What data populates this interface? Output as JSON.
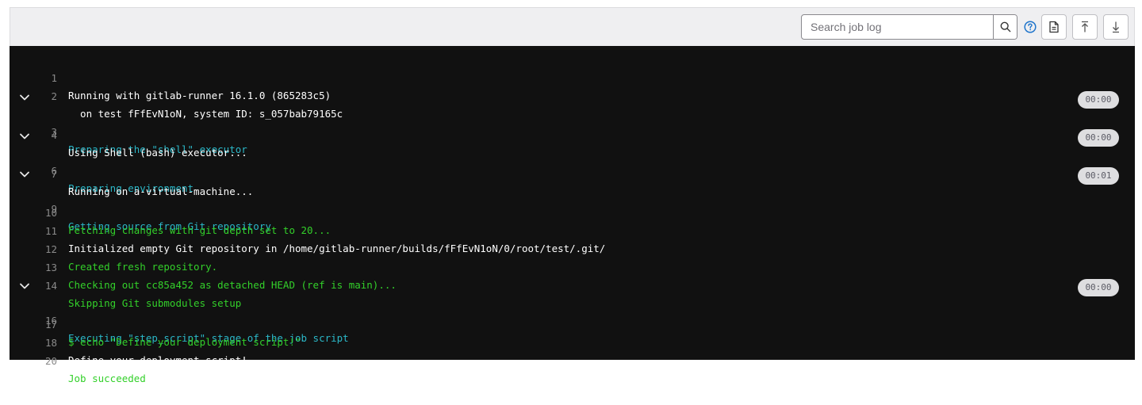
{
  "toolbar": {
    "search_placeholder": "Search job log",
    "search_value": "",
    "icons": {
      "search": "search-icon",
      "help": "question-circle-icon",
      "raw": "document-icon",
      "scroll_top": "scroll-up-icon",
      "scroll_bottom": "scroll-down-icon"
    },
    "accent_color": "#1f75cb"
  },
  "log": {
    "colors": {
      "background": "#111111",
      "line_number": "#8a8a8a",
      "section": "#2bb8c8",
      "success": "#33d02a",
      "default": "#ffffff"
    },
    "lines": [
      {
        "num": "1",
        "text": "Running with gitlab-runner 16.1.0 (865283c5)"
      },
      {
        "num": "2",
        "text": "  on test fFfEvN1oN, system ID: s_057bab79165c"
      },
      {
        "num": "3",
        "text": "Preparing the \"shell\" executor",
        "duration": "00:00"
      },
      {
        "num": "4",
        "text": "Using Shell (bash) executor..."
      },
      {
        "num": "6",
        "text": "Preparing environment",
        "duration": "00:00"
      },
      {
        "num": "7",
        "text": "Running on a-virtual-machine..."
      },
      {
        "num": "9",
        "text": "Getting source from Git repository",
        "duration": "00:01"
      },
      {
        "num": "10",
        "text": "Fetching changes with git depth set to 20..."
      },
      {
        "num": "11",
        "text": "Initialized empty Git repository in /home/gitlab-runner/builds/fFfEvN1oN/0/root/test/.git/"
      },
      {
        "num": "12",
        "text": "Created fresh repository."
      },
      {
        "num": "13",
        "text": "Checking out cc85a452 as detached HEAD (ref is main)..."
      },
      {
        "num": "14",
        "text": "Skipping Git submodules setup"
      },
      {
        "num": "16",
        "text": "Executing \"step_script\" stage of the job script",
        "duration": "00:00"
      },
      {
        "num": "17",
        "text": "$ echo \"Define your deployment script!\""
      },
      {
        "num": "18",
        "text": "Define your deployment script!"
      },
      {
        "num": "20",
        "text": "Job succeeded"
      }
    ]
  }
}
